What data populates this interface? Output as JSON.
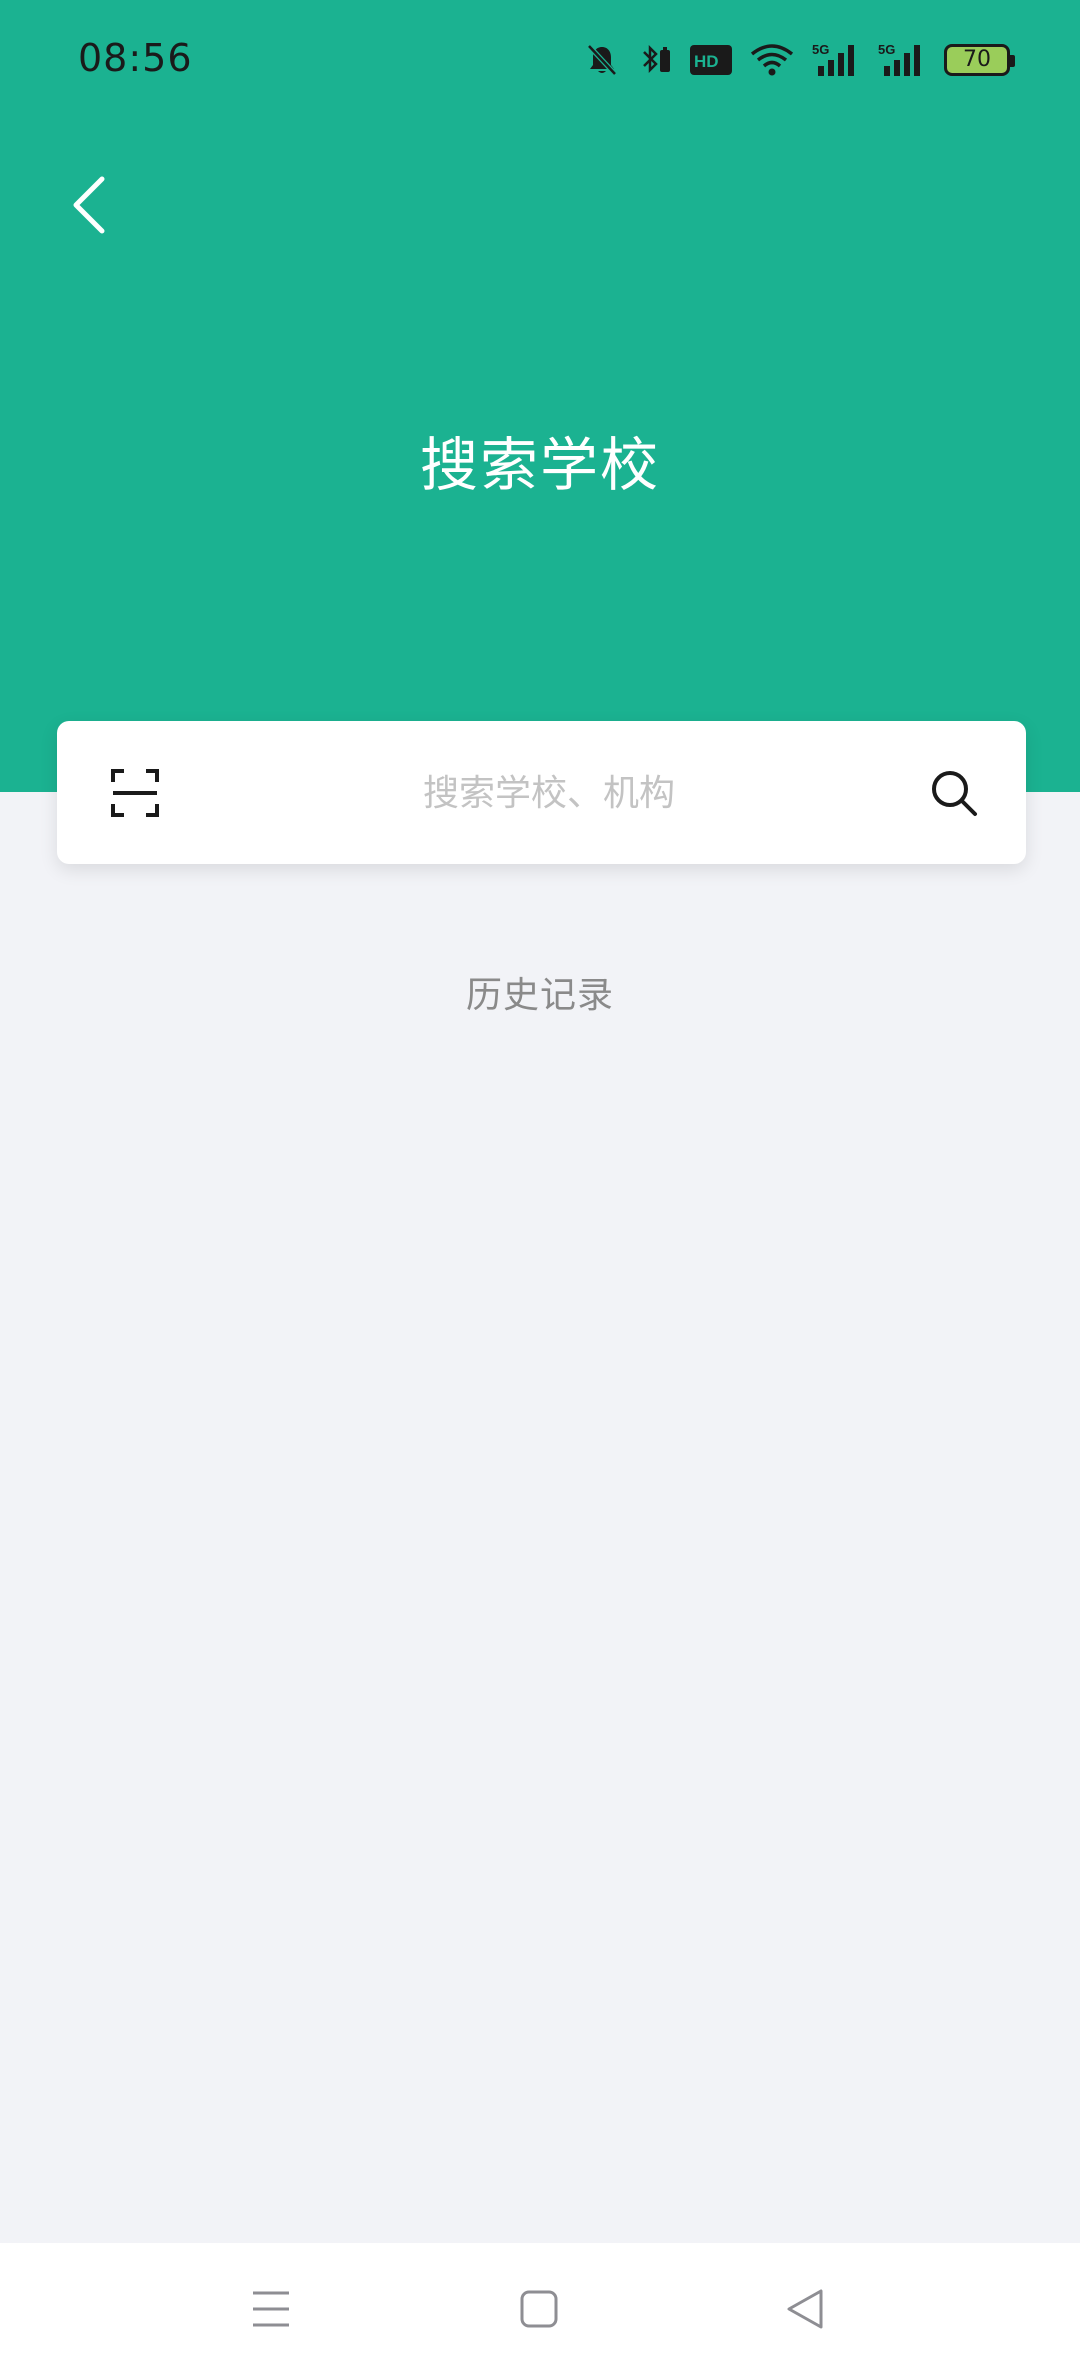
{
  "status_bar": {
    "time": "08:56",
    "battery_level": "70",
    "icons": [
      "bell-muted-icon",
      "bluetooth-icon",
      "hd-icon",
      "wifi-icon",
      "signal-5g-icon",
      "signal-5g-icon",
      "battery-icon"
    ],
    "hd_label": "HD",
    "network_label": "5G"
  },
  "header": {
    "title": "搜索学校",
    "background_color": "#1BB291"
  },
  "search": {
    "placeholder": "搜索学校、机构",
    "value": ""
  },
  "history": {
    "title": "历史记录",
    "items": []
  },
  "nav_bar": {
    "icons": [
      "menu-icon",
      "home-icon",
      "back-triangle-icon"
    ]
  }
}
